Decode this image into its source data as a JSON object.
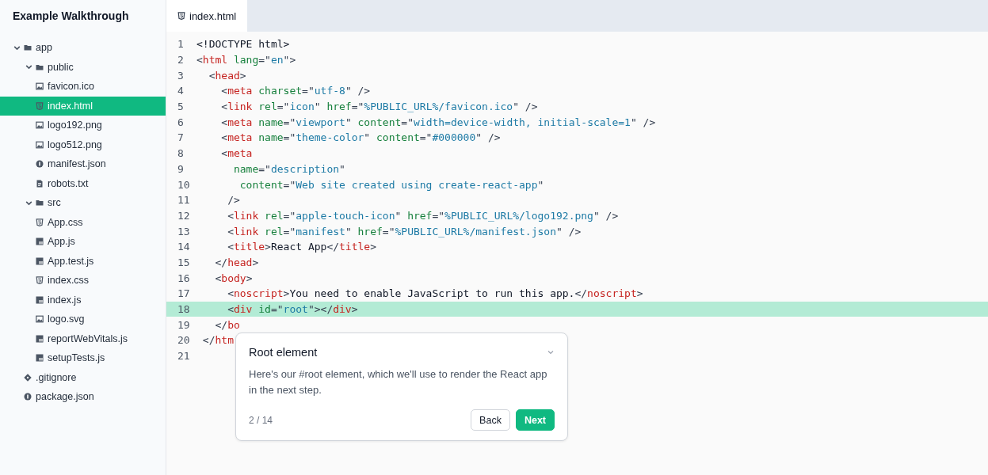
{
  "sidebar": {
    "title": "Example Walkthrough",
    "tree": [
      {
        "name": "app",
        "kind": "folder",
        "expanded": true,
        "selected": false,
        "children": [
          {
            "name": "public",
            "kind": "folder",
            "expanded": true,
            "selected": false,
            "children": [
              {
                "name": "favicon.ico",
                "kind": "image",
                "selected": false
              },
              {
                "name": "index.html",
                "kind": "html",
                "selected": true
              },
              {
                "name": "logo192.png",
                "kind": "image",
                "selected": false
              },
              {
                "name": "logo512.png",
                "kind": "image",
                "selected": false
              },
              {
                "name": "manifest.json",
                "kind": "json",
                "selected": false
              },
              {
                "name": "robots.txt",
                "kind": "text",
                "selected": false
              }
            ]
          },
          {
            "name": "src",
            "kind": "folder",
            "expanded": true,
            "selected": false,
            "children": [
              {
                "name": "App.css",
                "kind": "css",
                "selected": false
              },
              {
                "name": "App.js",
                "kind": "js",
                "selected": false
              },
              {
                "name": "App.test.js",
                "kind": "js",
                "selected": false
              },
              {
                "name": "index.css",
                "kind": "css",
                "selected": false
              },
              {
                "name": "index.js",
                "kind": "js",
                "selected": false
              },
              {
                "name": "logo.svg",
                "kind": "image",
                "selected": false
              },
              {
                "name": "reportWebVitals.js",
                "kind": "js",
                "selected": false
              },
              {
                "name": "setupTests.js",
                "kind": "js",
                "selected": false
              }
            ]
          },
          {
            "name": ".gitignore",
            "kind": "git",
            "selected": false
          },
          {
            "name": "package.json",
            "kind": "json",
            "selected": false
          }
        ]
      }
    ]
  },
  "tabs": [
    {
      "label": "index.html",
      "kind": "html",
      "selected": true
    }
  ],
  "editor": {
    "lines": [
      {
        "number": "1",
        "highlighted": false,
        "tokens": [
          {
            "kind": "plain",
            "text": "<!DOCTYPE html>"
          }
        ]
      },
      {
        "number": "2",
        "highlighted": false,
        "tokens": [
          {
            "kind": "punct",
            "text": "<"
          },
          {
            "kind": "tag",
            "text": "html"
          },
          {
            "kind": "attr",
            "text": " lang"
          },
          {
            "kind": "punct",
            "text": "=\""
          },
          {
            "kind": "string",
            "text": "en"
          },
          {
            "kind": "punct",
            "text": "\">"
          }
        ]
      },
      {
        "number": "3",
        "highlighted": false,
        "tokens": [
          {
            "kind": "punct",
            "text": "  <"
          },
          {
            "kind": "tag",
            "text": "head"
          },
          {
            "kind": "punct",
            "text": ">"
          }
        ]
      },
      {
        "number": "4",
        "highlighted": false,
        "tokens": [
          {
            "kind": "punct",
            "text": "    <"
          },
          {
            "kind": "tag",
            "text": "meta"
          },
          {
            "kind": "attr",
            "text": " charset"
          },
          {
            "kind": "punct",
            "text": "=\""
          },
          {
            "kind": "string",
            "text": "utf-8"
          },
          {
            "kind": "punct",
            "text": "\" />"
          }
        ]
      },
      {
        "number": "5",
        "highlighted": false,
        "tokens": [
          {
            "kind": "punct",
            "text": "    <"
          },
          {
            "kind": "tag",
            "text": "link"
          },
          {
            "kind": "attr",
            "text": " rel"
          },
          {
            "kind": "punct",
            "text": "=\""
          },
          {
            "kind": "string",
            "text": "icon"
          },
          {
            "kind": "punct",
            "text": "\" "
          },
          {
            "kind": "attr",
            "text": "href"
          },
          {
            "kind": "punct",
            "text": "=\""
          },
          {
            "kind": "string",
            "text": "%PUBLIC_URL%/favicon.ico"
          },
          {
            "kind": "punct",
            "text": "\" />"
          }
        ]
      },
      {
        "number": "6",
        "highlighted": false,
        "tokens": [
          {
            "kind": "punct",
            "text": "    <"
          },
          {
            "kind": "tag",
            "text": "meta"
          },
          {
            "kind": "attr",
            "text": " name"
          },
          {
            "kind": "punct",
            "text": "=\""
          },
          {
            "kind": "string",
            "text": "viewport"
          },
          {
            "kind": "punct",
            "text": "\" "
          },
          {
            "kind": "attr",
            "text": "content"
          },
          {
            "kind": "punct",
            "text": "=\""
          },
          {
            "kind": "string",
            "text": "width=device-width, initial-scale=1"
          },
          {
            "kind": "punct",
            "text": "\" />"
          }
        ]
      },
      {
        "number": "7",
        "highlighted": false,
        "tokens": [
          {
            "kind": "punct",
            "text": "    <"
          },
          {
            "kind": "tag",
            "text": "meta"
          },
          {
            "kind": "attr",
            "text": " name"
          },
          {
            "kind": "punct",
            "text": "=\""
          },
          {
            "kind": "string",
            "text": "theme-color"
          },
          {
            "kind": "punct",
            "text": "\" "
          },
          {
            "kind": "attr",
            "text": "content"
          },
          {
            "kind": "punct",
            "text": "=\""
          },
          {
            "kind": "string",
            "text": "#000000"
          },
          {
            "kind": "punct",
            "text": "\" />"
          }
        ]
      },
      {
        "number": "8",
        "highlighted": false,
        "tokens": [
          {
            "kind": "punct",
            "text": "    <"
          },
          {
            "kind": "tag",
            "text": "meta"
          }
        ]
      },
      {
        "number": "9",
        "highlighted": false,
        "tokens": [
          {
            "kind": "attr",
            "text": "      name"
          },
          {
            "kind": "punct",
            "text": "=\""
          },
          {
            "kind": "string",
            "text": "description"
          },
          {
            "kind": "punct",
            "text": "\""
          }
        ]
      },
      {
        "number": "10",
        "highlighted": false,
        "tokens": [
          {
            "kind": "attr",
            "text": "       content"
          },
          {
            "kind": "punct",
            "text": "=\""
          },
          {
            "kind": "string",
            "text": "Web site created using create-react-app"
          },
          {
            "kind": "punct",
            "text": "\""
          }
        ]
      },
      {
        "number": "11",
        "highlighted": false,
        "tokens": [
          {
            "kind": "punct",
            "text": "     />"
          }
        ]
      },
      {
        "number": "12",
        "highlighted": false,
        "tokens": [
          {
            "kind": "punct",
            "text": "     <"
          },
          {
            "kind": "tag",
            "text": "link"
          },
          {
            "kind": "attr",
            "text": " rel"
          },
          {
            "kind": "punct",
            "text": "=\""
          },
          {
            "kind": "string",
            "text": "apple-touch-icon"
          },
          {
            "kind": "punct",
            "text": "\" "
          },
          {
            "kind": "attr",
            "text": "href"
          },
          {
            "kind": "punct",
            "text": "=\""
          },
          {
            "kind": "string",
            "text": "%PUBLIC_URL%/logo192.png"
          },
          {
            "kind": "punct",
            "text": "\" />"
          }
        ]
      },
      {
        "number": "13",
        "highlighted": false,
        "tokens": [
          {
            "kind": "punct",
            "text": "     <"
          },
          {
            "kind": "tag",
            "text": "link"
          },
          {
            "kind": "attr",
            "text": " rel"
          },
          {
            "kind": "punct",
            "text": "=\""
          },
          {
            "kind": "string",
            "text": "manifest"
          },
          {
            "kind": "punct",
            "text": "\" "
          },
          {
            "kind": "attr",
            "text": "href"
          },
          {
            "kind": "punct",
            "text": "=\""
          },
          {
            "kind": "string",
            "text": "%PUBLIC_URL%/manifest.json"
          },
          {
            "kind": "punct",
            "text": "\" />"
          }
        ]
      },
      {
        "number": "14",
        "highlighted": false,
        "tokens": [
          {
            "kind": "punct",
            "text": "     <"
          },
          {
            "kind": "tag",
            "text": "title"
          },
          {
            "kind": "punct",
            "text": ">"
          },
          {
            "kind": "plain",
            "text": "React App"
          },
          {
            "kind": "punct",
            "text": "</"
          },
          {
            "kind": "tag",
            "text": "title"
          },
          {
            "kind": "punct",
            "text": ">"
          }
        ]
      },
      {
        "number": "15",
        "highlighted": false,
        "tokens": [
          {
            "kind": "punct",
            "text": "   </"
          },
          {
            "kind": "tag",
            "text": "head"
          },
          {
            "kind": "punct",
            "text": ">"
          }
        ]
      },
      {
        "number": "16",
        "highlighted": false,
        "tokens": [
          {
            "kind": "punct",
            "text": "   <"
          },
          {
            "kind": "tag",
            "text": "body"
          },
          {
            "kind": "punct",
            "text": ">"
          }
        ]
      },
      {
        "number": "17",
        "highlighted": false,
        "tokens": [
          {
            "kind": "punct",
            "text": "     <"
          },
          {
            "kind": "tag",
            "text": "noscript"
          },
          {
            "kind": "punct",
            "text": ">"
          },
          {
            "kind": "plain",
            "text": "You need to enable JavaScript to run this app."
          },
          {
            "kind": "punct",
            "text": "</"
          },
          {
            "kind": "tag",
            "text": "noscript"
          },
          {
            "kind": "punct",
            "text": ">"
          }
        ]
      },
      {
        "number": "18",
        "highlighted": true,
        "tokens": [
          {
            "kind": "punct",
            "text": "     <"
          },
          {
            "kind": "tag",
            "text": "div"
          },
          {
            "kind": "attr",
            "text": " id"
          },
          {
            "kind": "punct",
            "text": "=\""
          },
          {
            "kind": "string",
            "text": "root"
          },
          {
            "kind": "punct",
            "text": "\"></"
          },
          {
            "kind": "tag",
            "text": "div"
          },
          {
            "kind": "punct",
            "text": ">"
          }
        ]
      },
      {
        "number": "19",
        "highlighted": false,
        "tokens": [
          {
            "kind": "punct",
            "text": "   </"
          },
          {
            "kind": "tag",
            "text": "bo"
          }
        ]
      },
      {
        "number": "20",
        "highlighted": false,
        "tokens": [
          {
            "kind": "punct",
            "text": " </"
          },
          {
            "kind": "tag",
            "text": "htm"
          }
        ]
      },
      {
        "number": "21",
        "highlighted": false
      }
    ]
  },
  "popover": {
    "title": "Root element",
    "body": "Here's our #root element, which we'll use to render the React app in the next step.",
    "step": "2 / 14",
    "buttons": [
      {
        "label": "Back",
        "kind": "secondary"
      },
      {
        "label": "Next",
        "kind": "primary"
      }
    ]
  }
}
